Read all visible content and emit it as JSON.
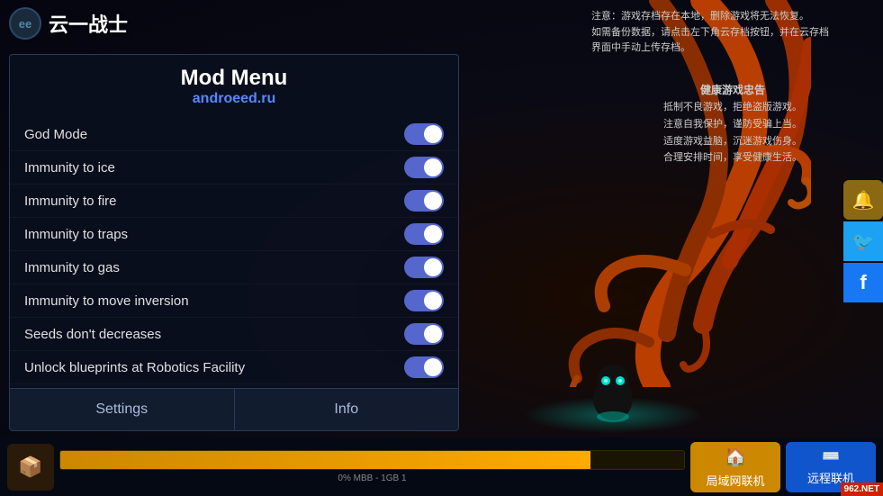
{
  "app": {
    "title": "云一战士",
    "logo_text": "ee"
  },
  "warnings": {
    "save_warning": "注意：游戏存档存在本地，删除游戏将无法恢复。\n如需备份数据，请点击左下角云存档按钮，并在云存档\n界面中手动上传存档。",
    "health_title": "健康游戏忠告",
    "health_line1": "抵制不良游戏，拒绝盗版游戏。",
    "health_line2": "注意自我保护，谨防受骗上当。",
    "health_line3": "适度游戏益脑，沉迷游戏伤身。",
    "health_line4": "合理安排时间，享受健康生活。"
  },
  "mod_menu": {
    "title": "Mod Menu",
    "subtitle": "androeed.ru",
    "items": [
      {
        "label": "God Mode",
        "enabled": true
      },
      {
        "label": "Immunity to ice",
        "enabled": true
      },
      {
        "label": "Immunity to fire",
        "enabled": true
      },
      {
        "label": "Immunity to traps",
        "enabled": true
      },
      {
        "label": "Immunity to gas",
        "enabled": true
      },
      {
        "label": "Immunity to move inversion",
        "enabled": true
      },
      {
        "label": "Seeds don't decreases",
        "enabled": true
      },
      {
        "label": "Unlock blueprints at Robotics Facility",
        "enabled": true
      }
    ],
    "footer": {
      "settings_label": "Settings",
      "info_label": "Info"
    }
  },
  "bottom_bar": {
    "progress_text": "0% MBB - 1GB 1",
    "lan_label": "局域网联机",
    "remote_label": "远程联机"
  },
  "social": {
    "bell_icon": "🔔",
    "twitter_icon": "🐦",
    "facebook_icon": "f"
  },
  "watermark": "962.NET"
}
